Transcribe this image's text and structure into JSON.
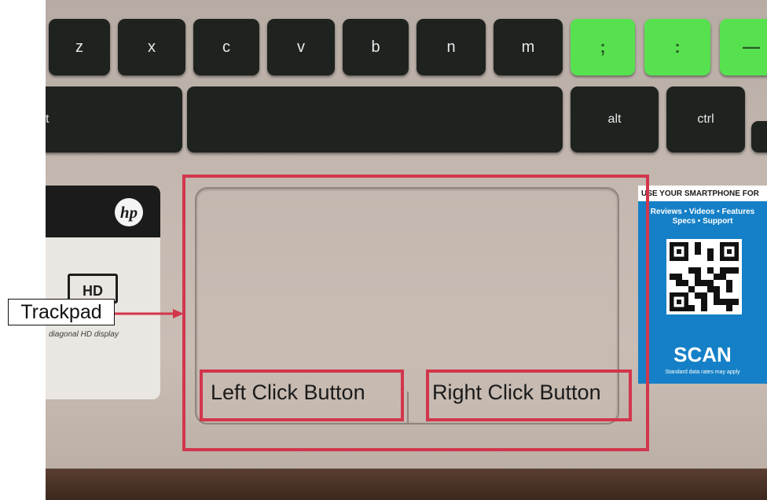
{
  "keys": {
    "row1": [
      "z",
      "x",
      "c",
      "v",
      "b",
      "n",
      "m"
    ],
    "green": [
      ";",
      ":",
      "—"
    ],
    "row2_left": "t",
    "alt": "alt",
    "ctrl": "ctrl"
  },
  "hp_sticker": {
    "logo": "hp",
    "hd": "HD",
    "caption": "diagonal HD display"
  },
  "qr_sticker": {
    "heading": "USE YOUR SMARTPHONE FOR",
    "line1": "Reviews • Videos • Features",
    "line2": "Specs • Support",
    "scan": "SCAN",
    "footer": "Standard data rates may apply"
  },
  "annotations": {
    "trackpad": "Trackpad",
    "left_click": "Left Click Button",
    "right_click": "Right Click Button",
    "highlight_color": "#d2364c"
  }
}
